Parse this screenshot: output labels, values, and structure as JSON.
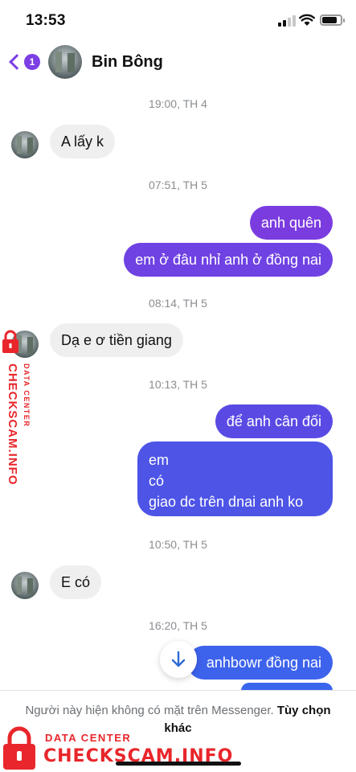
{
  "status_bar": {
    "time": "13:53"
  },
  "header": {
    "unread_count": "1",
    "contact_name": "Bin Bông"
  },
  "colors": {
    "accent": "#7b3fe4",
    "bubble_incoming": "#efefef",
    "watermark": "#e8262b"
  },
  "conversation": {
    "timestamps": [
      "19:00, TH 4",
      "07:51, TH 5",
      "08:14, TH 5",
      "10:13, TH 5",
      "10:50, TH 5",
      "16:20, TH 5"
    ],
    "messages": [
      {
        "direction": "in",
        "text": "A lấy k"
      },
      {
        "direction": "out",
        "text": "anh quên"
      },
      {
        "direction": "out",
        "text": "em ở đâu nhỉ anh ở đồng nai"
      },
      {
        "direction": "in",
        "text": "Dạ e ơ tiền giang"
      },
      {
        "direction": "out",
        "text": "để anh cân đối"
      },
      {
        "direction": "out",
        "lines": [
          "em",
          "có",
          "giao dc trên dnai anh ko"
        ]
      },
      {
        "direction": "in",
        "text": "E có"
      },
      {
        "direction": "out",
        "text": "anhbowr đồng nai"
      }
    ]
  },
  "footer": {
    "notice": "Người này hiện không có mặt trên Messenger.",
    "link": "Tùy chọn khác"
  },
  "watermark": {
    "label_top": "DATA CENTER",
    "label_main": "CHECKSCAM.INFO"
  }
}
